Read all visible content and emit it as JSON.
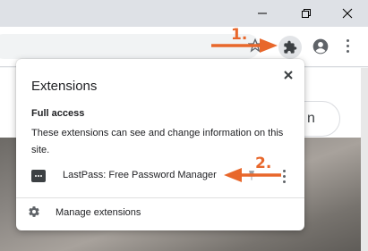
{
  "toolbar": {
    "icons": [
      "star-icon",
      "puzzle-icon",
      "profile-icon",
      "more-vert-icon"
    ]
  },
  "page": {
    "partial_button_text": "n"
  },
  "popup": {
    "title": "Extensions",
    "section_title": "Full access",
    "section_description": "These extensions can see and change information on this site.",
    "extension_name": "LastPass: Free Password Manager",
    "manage_label": "Manage extensions"
  },
  "annotations": {
    "step1": "1.",
    "step2": "2.",
    "color": "#e8672b"
  }
}
